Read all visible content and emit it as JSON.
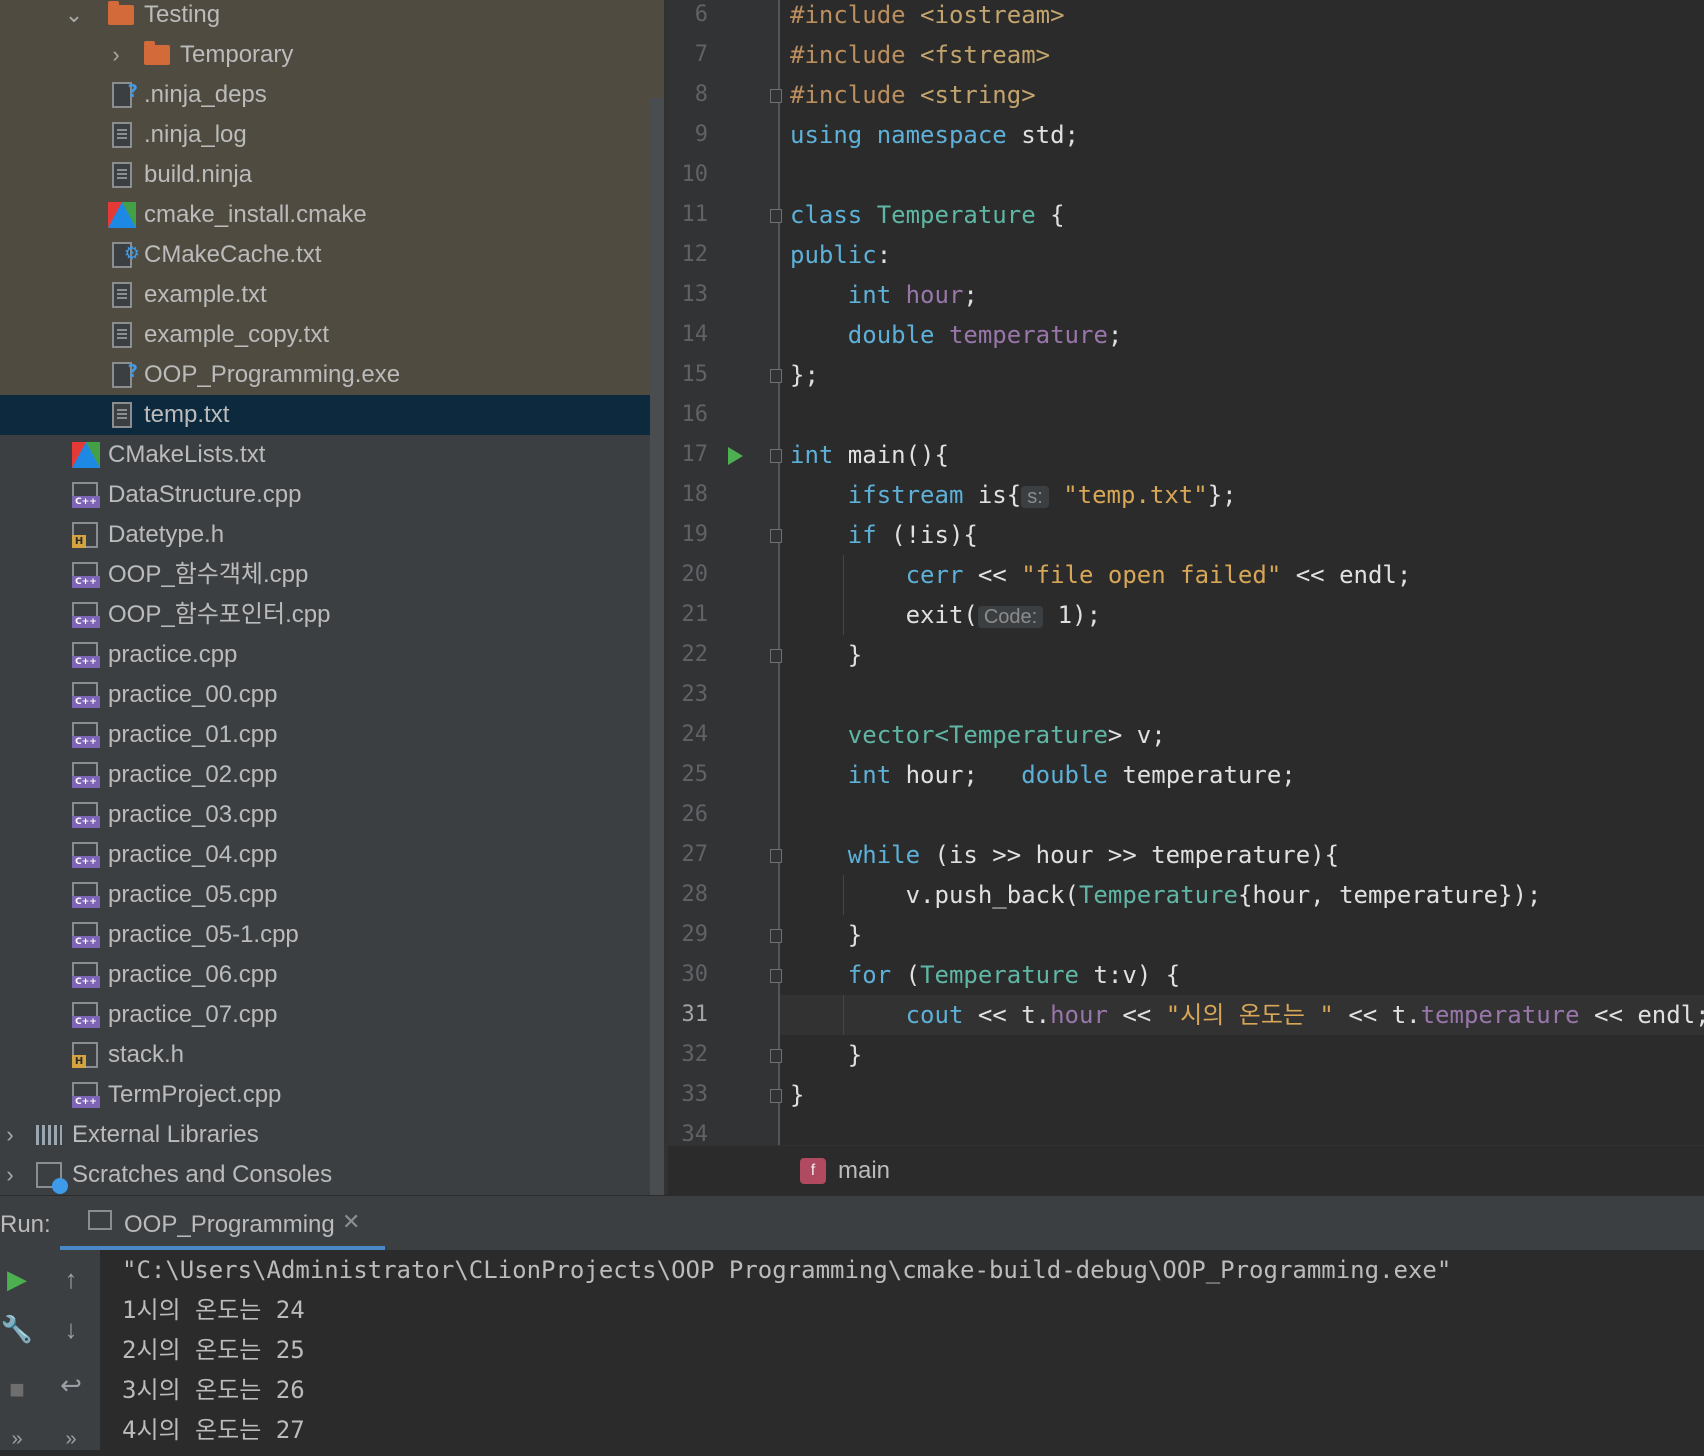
{
  "project_tree": {
    "rows": [
      {
        "label": "Testing",
        "icon": "folder-icon",
        "chevron": "down"
      },
      {
        "label": "Temporary",
        "icon": "folder-icon",
        "chevron": "right"
      },
      {
        "label": ".ninja_deps",
        "icon": "unknown-file-icon"
      },
      {
        "label": ".ninja_log",
        "icon": "text-file-icon"
      },
      {
        "label": "build.ninja",
        "icon": "text-file-icon"
      },
      {
        "label": "cmake_install.cmake",
        "icon": "cmake-icon"
      },
      {
        "label": "CMakeCache.txt",
        "icon": "cmake-cache-icon"
      },
      {
        "label": "example.txt",
        "icon": "text-file-icon"
      },
      {
        "label": "example_copy.txt",
        "icon": "text-file-icon"
      },
      {
        "label": "OOP_Programming.exe",
        "icon": "unknown-file-icon"
      },
      {
        "label": "temp.txt",
        "icon": "text-file-icon",
        "selected": true
      },
      {
        "label": "CMakeLists.txt",
        "icon": "cmake-icon"
      },
      {
        "label": "DataStructure.cpp",
        "icon": "cpp-file-icon"
      },
      {
        "label": "Datetype.h",
        "icon": "header-file-icon"
      },
      {
        "label": "OOP_함수객체.cpp",
        "icon": "cpp-file-icon"
      },
      {
        "label": "OOP_함수포인터.cpp",
        "icon": "cpp-file-icon"
      },
      {
        "label": "practice.cpp",
        "icon": "cpp-file-icon"
      },
      {
        "label": "practice_00.cpp",
        "icon": "cpp-file-icon"
      },
      {
        "label": "practice_01.cpp",
        "icon": "cpp-file-icon"
      },
      {
        "label": "practice_02.cpp",
        "icon": "cpp-file-icon"
      },
      {
        "label": "practice_03.cpp",
        "icon": "cpp-file-icon"
      },
      {
        "label": "practice_04.cpp",
        "icon": "cpp-file-icon"
      },
      {
        "label": "practice_05.cpp",
        "icon": "cpp-file-icon"
      },
      {
        "label": "practice_05-1.cpp",
        "icon": "cpp-file-icon"
      },
      {
        "label": "practice_06.cpp",
        "icon": "cpp-file-icon"
      },
      {
        "label": "practice_07.cpp",
        "icon": "cpp-file-icon"
      },
      {
        "label": "stack.h",
        "icon": "header-file-icon"
      },
      {
        "label": "TermProject.cpp",
        "icon": "cpp-file-icon"
      },
      {
        "label": "External Libraries",
        "icon": "library-icon",
        "chevron": "right"
      },
      {
        "label": "Scratches and Consoles",
        "icon": "scratches-icon",
        "chevron": "right"
      }
    ]
  },
  "editor": {
    "line_numbers": [
      "6",
      "7",
      "8",
      "9",
      "10",
      "11",
      "12",
      "13",
      "14",
      "15",
      "16",
      "17",
      "18",
      "19",
      "20",
      "21",
      "22",
      "23",
      "24",
      "25",
      "26",
      "27",
      "28",
      "29",
      "30",
      "31",
      "32",
      "33",
      "34"
    ],
    "current_line": "31",
    "code": {
      "l6_a": "#include",
      "l6_b": " <iostream>",
      "l7_a": "#include",
      "l7_b": " <fstream>",
      "l8_a": "#include",
      "l8_b": " <string>",
      "l9_a": "using",
      "l9_b": " namespace",
      "l9_c": " std;",
      "l11_a": "class",
      "l11_b": " Temperature",
      "l11_c": " {",
      "l12_a": "public",
      "l12_b": ":",
      "l13_a": "    int",
      "l13_b": " hour",
      "l13_c": ";",
      "l14_a": "    double",
      "l14_b": " temperature",
      "l14_c": ";",
      "l15_a": "};",
      "l17_a": "int",
      "l17_b": " main",
      "l17_c": "(){",
      "l18_a": "    ifstream",
      "l18_b": " is{",
      "l18_hint": "s:",
      "l18_c": " \"temp.txt\"",
      "l18_d": "};",
      "l19_a": "    if",
      "l19_b": " (!is){",
      "l20_a": "        cerr",
      "l20_b": " << ",
      "l20_c": "\"file open failed\"",
      "l20_d": " << endl;",
      "l21_a": "        exit(",
      "l21_hint": "Code:",
      "l21_b": " 1);",
      "l22_a": "    }",
      "l24_a": "    vector<",
      "l24_b": "Temperature",
      "l24_c": "> v;",
      "l25_a": "    int",
      "l25_b": " hour;   ",
      "l25_c": "double",
      "l25_d": " temperature;",
      "l27_a": "    while",
      "l27_b": " (is >> hour >> temperature){",
      "l28_a": "        v.push_back(",
      "l28_b": "Temperature",
      "l28_c": "{hour, temperature});",
      "l29_a": "    }",
      "l30_a": "    for",
      "l30_b": " (",
      "l30_c": "Temperature",
      "l30_d": " t:v) {",
      "l31_a": "        cout",
      "l31_b": " << t.",
      "l31_c": "hour",
      "l31_d": " << ",
      "l31_e": "\"시의 온도는 \"",
      "l31_f": " << t.",
      "l31_g": "temperature",
      "l31_h": " << endl;",
      "l32_a": "    }",
      "l33_a": "}"
    },
    "breadcrumb": {
      "badge": "f",
      "label": "main"
    }
  },
  "run_panel": {
    "label": "Run:",
    "tab_label": "OOP_Programming",
    "close_glyph": "✕",
    "console_lines": [
      "\"C:\\Users\\Administrator\\CLionProjects\\OOP Programming\\cmake-build-debug\\OOP_Programming.exe\"",
      "1시의 온도는 24",
      "2시의 온도는 25",
      "3시의 온도는 26",
      "4시의 온도는 27"
    ]
  },
  "colors": {
    "tree_bg": "#3c3f41",
    "tree_highlight": "#4f4b41",
    "tree_selected": "#0d293e",
    "editor_bg": "#2b2b2b",
    "keyword": "#5db0d7",
    "string": "#d8a657",
    "field": "#9876aa",
    "tab_underline": "#4a88c7"
  }
}
